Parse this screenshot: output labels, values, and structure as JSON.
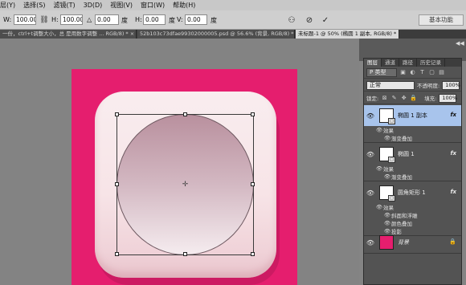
{
  "menu": [
    "层(Y)",
    "选择(S)",
    "滤镜(T)",
    "3D(D)",
    "视图(V)",
    "窗口(W)",
    "帮助(H)"
  ],
  "options": {
    "w_label": "W:",
    "w_value": "100.00%",
    "link_icon": "link-icon",
    "h_label": "H:",
    "h_value": "100.00%",
    "angle_label": "△",
    "angle_value": "0.00",
    "angle_unit": "度",
    "hskew_label": "H:",
    "hskew_value": "0.00",
    "hskew_unit": "度",
    "vskew_label": "V:",
    "vskew_value": "0.00",
    "vskew_unit": "度",
    "warp_icon": "warp-icon",
    "cancel_icon": "cancel-icon",
    "commit_icon": "commit-icon",
    "workspace": "基本功能"
  },
  "tabs": [
    {
      "label": "一份，ctrl+t调整大小，总 是用数字调整 ... RGB/8) * ×",
      "active": false
    },
    {
      "label": "52b103c73dfae99302000005.psd @ 56.6% (背景, RGB/8) * ×",
      "active": false
    },
    {
      "label": "未标题-1 @ 50% (椭圆 1 副本, RGB/8) * ×",
      "active": true
    }
  ],
  "panel": {
    "tabs": [
      "图层",
      "通道",
      "路径",
      "历史记录"
    ],
    "filter_label": "P 类型",
    "blend_mode": "正常",
    "opacity_label": "不透明度:",
    "opacity_value": "100%",
    "lock_label": "锁定:",
    "fill_label": "填充:",
    "fill_value": "100%"
  },
  "layers": [
    {
      "name": "椭圆 1 副本",
      "selected": true,
      "effects_label": "效果",
      "effects": [
        "渐变叠加"
      ],
      "fx": "fx"
    },
    {
      "name": "椭圆 1",
      "selected": false,
      "effects_label": "效果",
      "effects": [
        "渐变叠加"
      ],
      "fx": "fx"
    },
    {
      "name": "圆角矩形 1",
      "selected": false,
      "effects_label": "效果",
      "effects": [
        "斜面和浮雕",
        "颜色叠加",
        "投影"
      ],
      "fx": "fx"
    },
    {
      "name": "背景",
      "selected": false,
      "effects": [],
      "locked": true
    }
  ],
  "colors": {
    "canvas_bg": "#e51e6e",
    "selected_layer": "#a8c4ec",
    "panel_bg": "#535353"
  }
}
